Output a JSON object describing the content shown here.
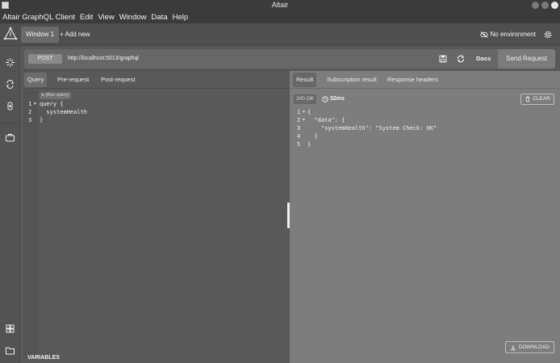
{
  "titlebar": {
    "title": "Altair"
  },
  "menu": [
    "Altair GraphQL Client",
    "Edit",
    "View",
    "Window",
    "Data",
    "Help"
  ],
  "tabs": {
    "window_tab": "Window 1",
    "add_new": "+ Add new"
  },
  "environment": {
    "label": "No environment"
  },
  "request": {
    "method": "POST",
    "url": "http://localhost:5013/graphql",
    "docs_label": "Docs",
    "send_label": "Send Request"
  },
  "query_panel": {
    "tabs": [
      "Query",
      "Pre-request",
      "Post-request"
    ],
    "active_tab": "Query",
    "run_query_label": "▸ (Run query)",
    "line_numbers": [
      "1",
      "2",
      "3"
    ],
    "code_lines": [
      "query {",
      "  systemHealth",
      "}"
    ],
    "variables_label": "VARIABLES"
  },
  "result_panel": {
    "tabs": [
      "Result",
      "Subscription result",
      "Response headers"
    ],
    "active_tab": "Result",
    "status": "200 OK",
    "time": "32ms",
    "clear_label": "CLEAR",
    "download_label": "DOWNLOAD",
    "line_numbers": [
      "1",
      "2",
      "3",
      "4",
      "5"
    ],
    "code_lines": [
      "{",
      "  \"data\": {",
      "    \"systemHealth\": \"System Check: OK\"",
      "  }",
      "}"
    ]
  },
  "colors": {
    "background": "#585858",
    "titlebar": "#3b3b3b",
    "result_panel": "#7d7d7d",
    "send_button": "#7b7b7b"
  }
}
